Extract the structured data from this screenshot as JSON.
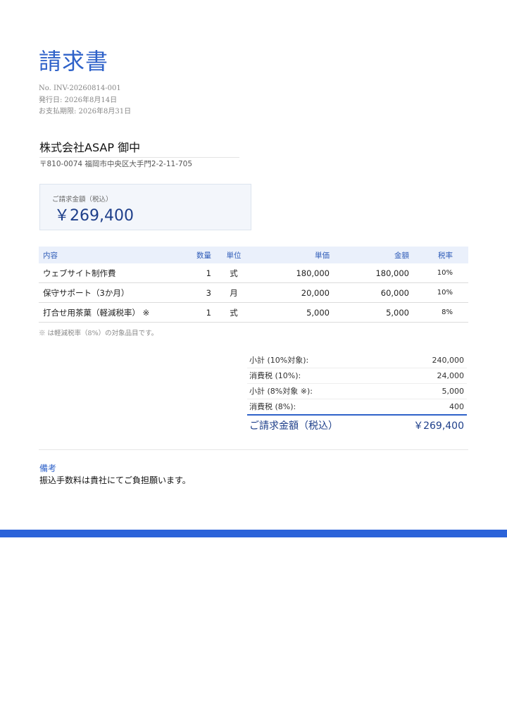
{
  "title": "請求書",
  "meta": {
    "number": "No. INV-20260814-001",
    "issue_date": "発行日: 2026年8月14日",
    "due_date": "お支払期限: 2026年8月31日"
  },
  "client": {
    "name": "株式会社ASAP 御中",
    "address": "〒810-0074 福岡市中央区大手門2-2-11-705"
  },
  "total_box": {
    "label": "ご請求金額（税込）",
    "amount": "￥269,400"
  },
  "items_table": {
    "headers": [
      "内容",
      "数量",
      "単位",
      "単価",
      "金額",
      "税率"
    ],
    "rows": [
      [
        "ウェブサイト制作費",
        "1",
        "式",
        "180,000",
        "180,000",
        "10%"
      ],
      [
        "保守サポート（3か月）",
        "3",
        "月",
        "20,000",
        "60,000",
        "10%"
      ],
      [
        "打合せ用茶菓（軽減税率） ※",
        "1",
        "式",
        "5,000",
        "5,000",
        "8%"
      ]
    ]
  },
  "note": "※ は軽減税率（8%）の対象品目です。",
  "summary": {
    "rows": [
      {
        "label": "小計 (10%対象):",
        "value": "240,000"
      },
      {
        "label": "消費税 (10%):",
        "value": "24,000"
      },
      {
        "label": "小計 (8%対象 ※):",
        "value": "5,000"
      },
      {
        "label": "消費税 (8%):",
        "value": "400"
      }
    ],
    "grand_label": "ご請求金額（税込）",
    "grand_value": "￥269,400"
  },
  "remarks": {
    "heading": "備考",
    "text": "振込手数料は貴社にてご負担願います。"
  },
  "colors": {
    "accent": "#2f62c9",
    "dark_accent": "#1e3f8a",
    "bottom_bar": "#2b63d9"
  }
}
